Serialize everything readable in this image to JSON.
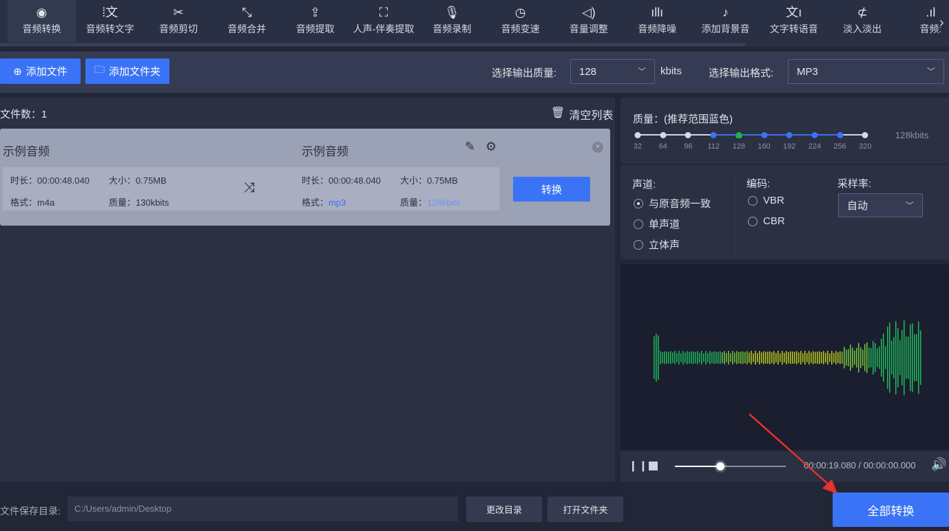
{
  "nav": {
    "items": [
      {
        "label": "音频转换",
        "icon": "audio-convert-icon",
        "glyph": "◉"
      },
      {
        "label": "音频转文字",
        "icon": "speech-to-text-icon",
        "glyph": "⁞文"
      },
      {
        "label": "音频剪切",
        "icon": "scissors-icon",
        "glyph": "✂"
      },
      {
        "label": "音频合并",
        "icon": "merge-icon",
        "glyph": "⤡"
      },
      {
        "label": "音频提取",
        "icon": "share-upload-icon",
        "glyph": "⇪"
      },
      {
        "label": "人声-伴奏提取",
        "icon": "vocal-extract-icon",
        "glyph": "⛶"
      },
      {
        "label": "音频录制",
        "icon": "microphone-icon",
        "glyph": "🎙"
      },
      {
        "label": "音频变速",
        "icon": "speedometer-icon",
        "glyph": "◷"
      },
      {
        "label": "音量调整",
        "icon": "speaker-icon",
        "glyph": "◁)"
      },
      {
        "label": "音频降噪",
        "icon": "denoise-icon",
        "glyph": "ıllı"
      },
      {
        "label": "添加背景音",
        "icon": "music-note-icon",
        "glyph": "♪"
      },
      {
        "label": "文字转语音",
        "icon": "text-to-speech-icon",
        "glyph": "文ı"
      },
      {
        "label": "淡入淡出",
        "icon": "fade-icon",
        "glyph": "⊄"
      },
      {
        "label": "音频:",
        "icon": "bars-icon",
        "glyph": ".ıl"
      }
    ]
  },
  "toolbar": {
    "add_file": "添加文件",
    "add_folder": "添加文件夹",
    "quality_label": "选择输出质量:",
    "quality_value": "128",
    "quality_unit": "kbits",
    "format_label": "选择输出格式:",
    "format_value": "MP3"
  },
  "list": {
    "file_count": "文件数：1",
    "clear": "清空列表",
    "item": {
      "src_name": "示例音频",
      "src_duration": "时长：00:00:48.040",
      "src_size": "大小：0.75MB",
      "src_format_label": "格式：",
      "src_format": "m4a",
      "src_quality_label": "质量：",
      "src_quality": "130kbits",
      "dst_name": "示例音频",
      "dst_duration": "时长：00:00:48.040",
      "dst_size": "大小：0.75MB",
      "dst_format_label": "格式：",
      "dst_format": "mp3",
      "dst_quality_label": "质量：",
      "dst_quality": "128kbits",
      "convert": "转换"
    }
  },
  "settings": {
    "quality_title": "质量：(推荐范围蓝色)",
    "quality_ticks": [
      "32",
      "64",
      "96",
      "112",
      "128",
      "160",
      "192",
      "224",
      "256",
      "320"
    ],
    "quality_selected_index": 4,
    "recommended_range": [
      3,
      8
    ],
    "quality_readout": "128kbits",
    "channel_label": "声道:",
    "channels": [
      "与原音频一致",
      "单声道",
      "立体声"
    ],
    "channel_selected": 0,
    "codec_label": "编码:",
    "codecs": [
      "VBR",
      "CBR"
    ],
    "samplerate_label": "采样率:",
    "samplerate_value": "自动"
  },
  "player": {
    "time": "00:00:19.080 / 00:00:00.000",
    "progress": 0.41
  },
  "bottom": {
    "save_label": "文件保存目录:",
    "save_path": "C:/Users/admin/Desktop",
    "change_dir": "更改目录",
    "open_folder": "打开文件夹",
    "convert_all": "全部转换"
  },
  "colors": {
    "accent": "#3a73f5",
    "selected_tick": "#22b14c",
    "arrow": "#e8332a"
  }
}
